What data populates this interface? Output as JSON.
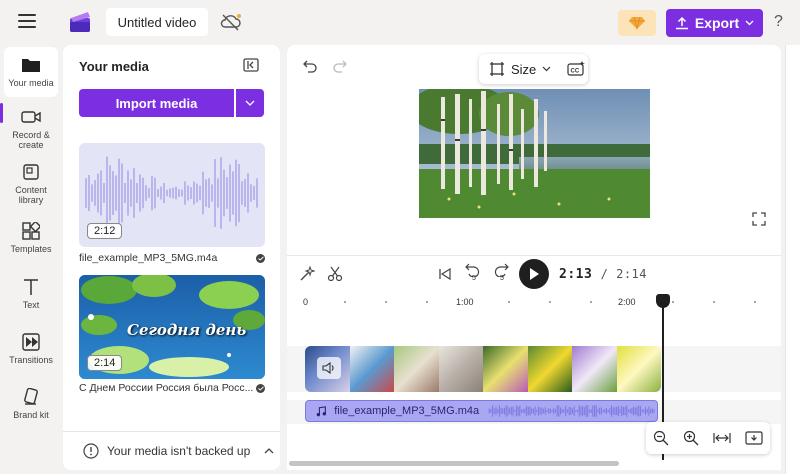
{
  "topbar": {
    "project_title": "Untitled video",
    "export_label": "Export",
    "help_label": "?"
  },
  "nav": [
    {
      "label": "Your media",
      "icon": "folder-icon"
    },
    {
      "label": "Record & create",
      "icon": "camera-icon"
    },
    {
      "label": "Content library",
      "icon": "library-icon"
    },
    {
      "label": "Templates",
      "icon": "templates-icon"
    },
    {
      "label": "Text",
      "icon": "text-icon"
    },
    {
      "label": "Transitions",
      "icon": "transitions-icon"
    },
    {
      "label": "Brand kit",
      "icon": "brand-kit-icon"
    }
  ],
  "media": {
    "title": "Your media",
    "import_label": "Import media",
    "items": [
      {
        "name": "file_example_MP3_5MG.m4a",
        "duration": "2:12"
      },
      {
        "name": "С Днем России Россия была Росс...",
        "duration": "2:14",
        "overlay_text": "Сегодня день"
      }
    ],
    "backup_text": "Your media isn't backed up"
  },
  "preview": {
    "size_label": "Size"
  },
  "timeline": {
    "current_time": "2:13",
    "total_time": "/ 2:14",
    "ruler_labels": [
      "0",
      "1:00",
      "2:00"
    ],
    "audio_clip_name": "file_example_MP3_5MG.m4a",
    "rewind_label": "5",
    "forward_label": "5"
  },
  "colors": {
    "accent": "#7b2fe0",
    "audio_clip": "#a9a6f2",
    "premium": "#fde3b8"
  }
}
